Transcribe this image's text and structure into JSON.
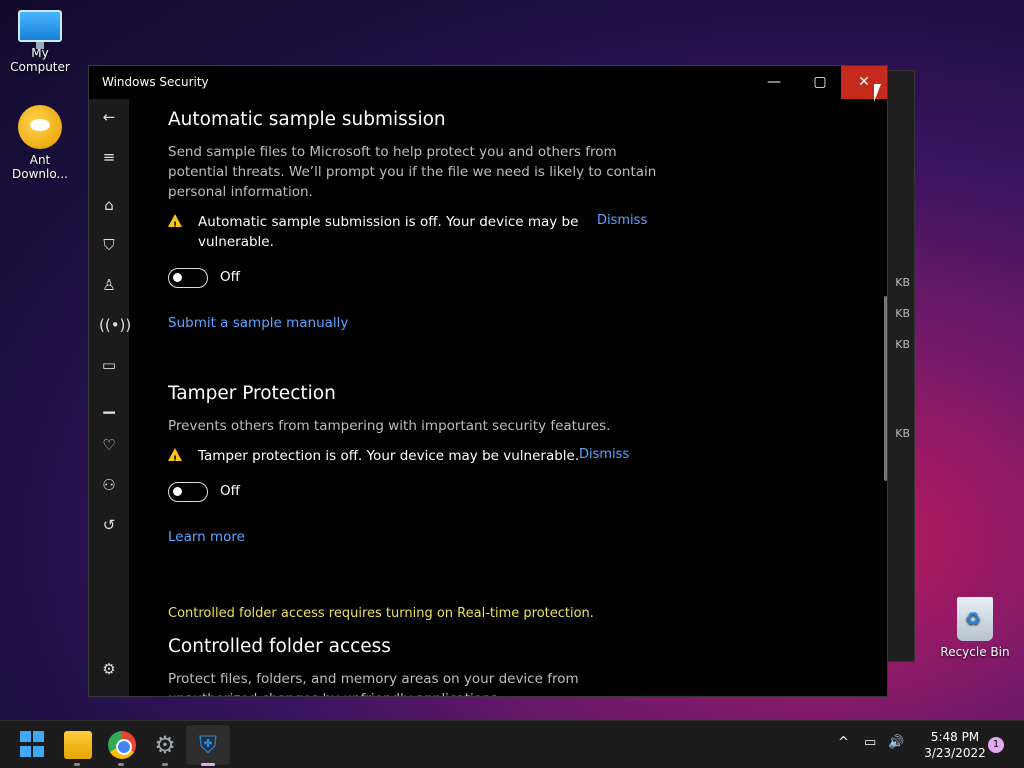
{
  "desktop": {
    "icons": [
      {
        "label": "My Computer"
      },
      {
        "label": "Ant\nDownlo..."
      },
      {
        "label": "Recycle Bin"
      }
    ]
  },
  "background_window": {
    "size_labels": [
      "KB",
      "KB",
      "KB",
      "KB"
    ]
  },
  "window": {
    "title": "Windows Security",
    "controls": {
      "minimize": "—",
      "maximize": "▢",
      "close": "✕"
    },
    "sidebar_icons": [
      "back-arrow-icon",
      "hamburger-menu-icon",
      "home-icon",
      "shield-icon",
      "account-icon",
      "wireless-icon",
      "app-browser-icon",
      "device-laptop-icon",
      "health-heart-icon",
      "family-icon",
      "history-icon",
      "settings-gear-icon"
    ],
    "sections": {
      "sample": {
        "heading": "Automatic sample submission",
        "description": "Send sample files to Microsoft to help protect you and others from potential threats. We’ll prompt you if the file we need is likely to contain personal information.",
        "warning": "Automatic sample submission is off. Your device may be vulnerable.",
        "dismiss": "Dismiss",
        "toggle_state": "Off",
        "link": "Submit a sample manually"
      },
      "tamper": {
        "heading": "Tamper Protection",
        "description": "Prevents others from tampering with important security features.",
        "warning": "Tamper protection is off. Your device may be vulnerable.",
        "dismiss": "Dismiss",
        "toggle_state": "Off",
        "link": "Learn more"
      },
      "folder": {
        "note": "Controlled folder access requires turning on Real-time protection.",
        "heading": "Controlled folder access",
        "description": "Protect files, folders, and memory areas on your device from unauthorized changes by unfriendly applications."
      }
    }
  },
  "taskbar": {
    "clock_time": "5:48 PM",
    "clock_date": "3/23/2022",
    "notification_count": "1",
    "tray": {
      "chevron": "^",
      "network": "▭",
      "volume": "🔊"
    }
  },
  "colors": {
    "link": "#5ba4ff",
    "warning": "#fcc419",
    "note": "#e8e25a",
    "close": "#c42b1c"
  }
}
